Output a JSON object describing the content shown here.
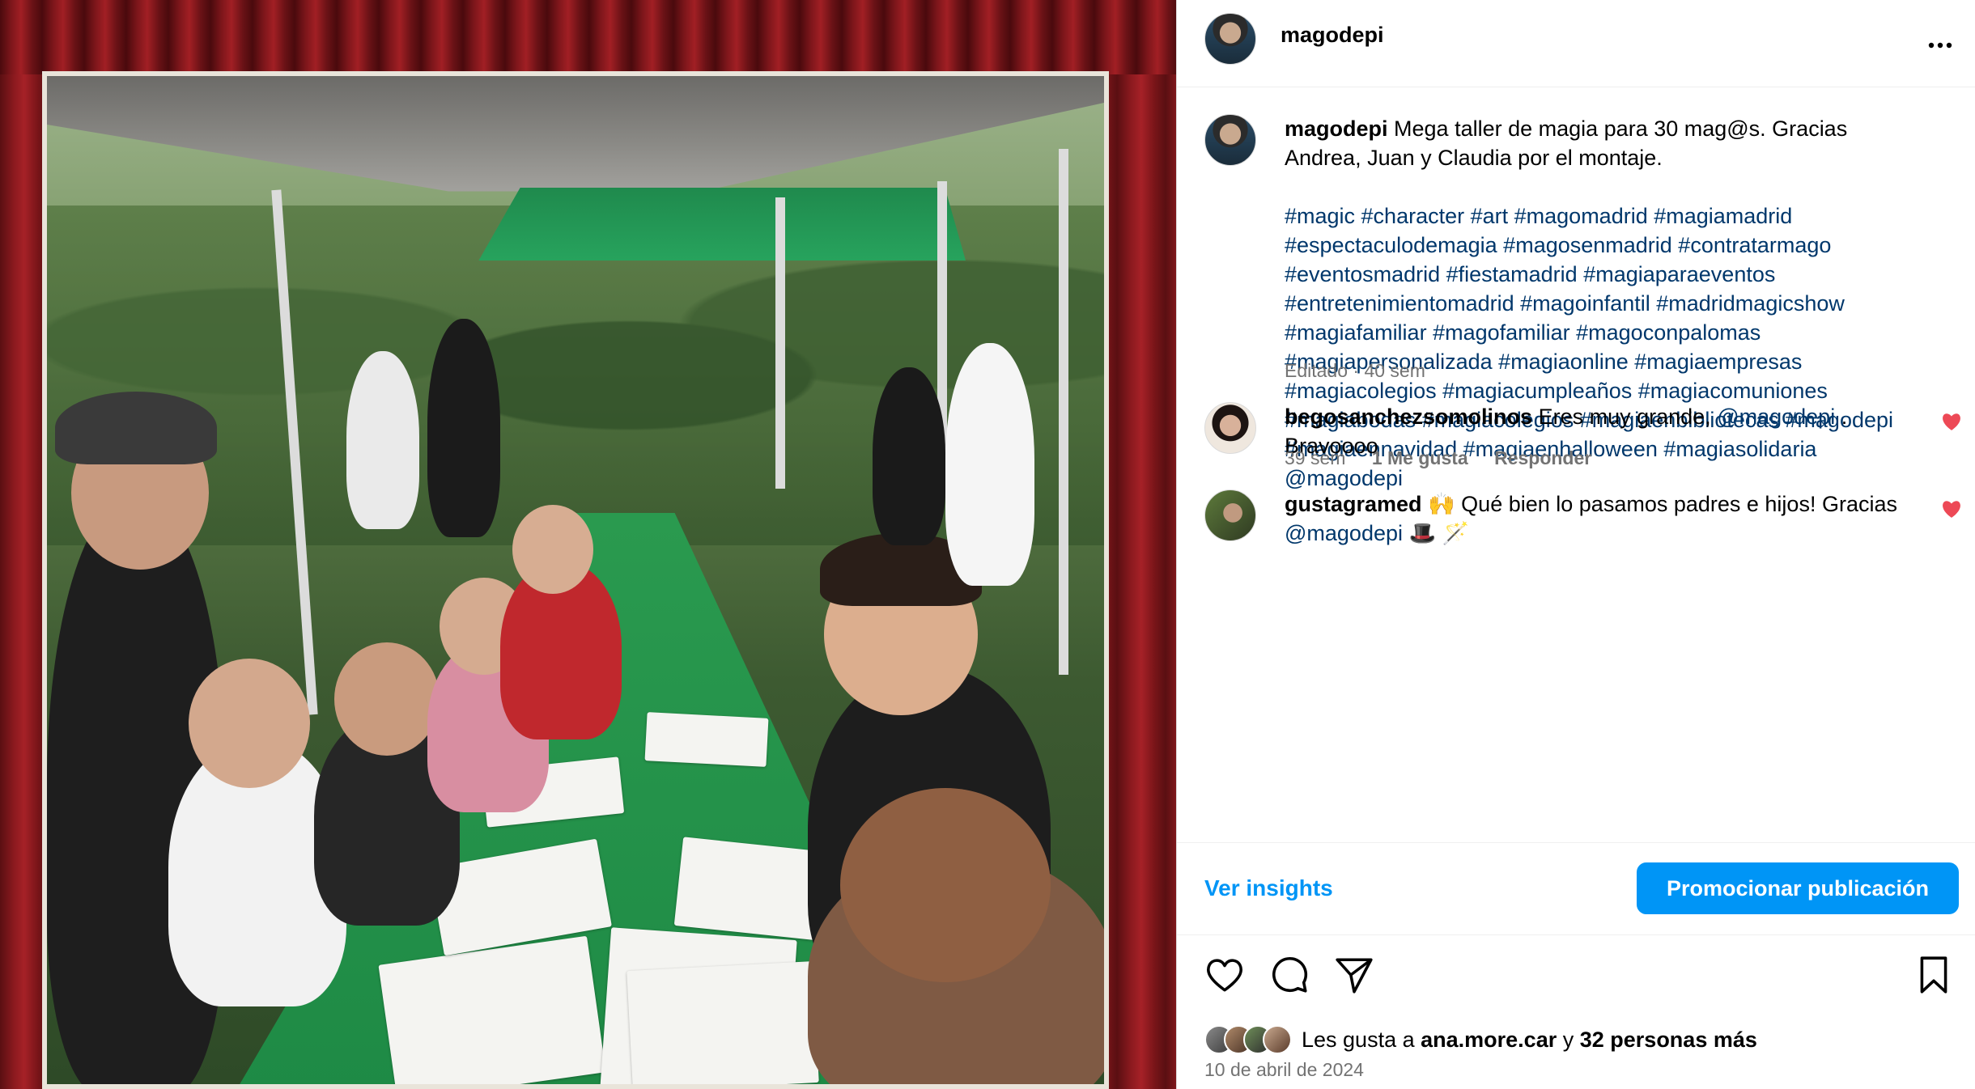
{
  "post": {
    "username": "magodepi",
    "more_icon": "more-horizontal-icon",
    "caption_user": "magodepi",
    "caption_text": "Mega taller de magia para 30 mag@s. Gracias Andrea, Juan y Claudia por el montaje.",
    "hashtags": "#magic #character #art #magomadrid #magiamadrid #espectaculodemagia #magosenmadrid #contratarmago #eventosmadrid #fiestamadrid #magiaparaeventos #entretenimientomadrid #magoinfantil #madridmagicshow #magiafamiliar #magofamiliar #magoconpalomas #magiapersonalizada #magiaonline #magiaempresas #magiacolegios #magiacumpleaños #magiacomuniones #magiabodas #magiacolegios #magiaenbibliotecas #magodepi #magiaennavidad #magiaenhalloween #magiasolidaria @magodepi",
    "caption_meta": "Editado · 40 sem"
  },
  "comments": [
    {
      "user": "begosanchezsomolinos",
      "text": "Eres muy grande,",
      "mention": "@magodepi",
      "text_after": ". Bravoooo",
      "time": "39 sem",
      "likes": "1 Me gusta",
      "reply": "Responder"
    },
    {
      "user": "gustagramed",
      "text": "🙌 Qué bien lo pasamos padres e hijos! Gracias",
      "mention": "@magodepi",
      "text_after": "🎩 🪄"
    }
  ],
  "actions": {
    "insights": "Ver insights",
    "promote": "Promocionar publicación"
  },
  "icons": [
    "heart-icon",
    "comment-icon",
    "share-icon",
    "bookmark-icon"
  ],
  "likes": {
    "prefix": "Les gusta a",
    "user": "ana.more.car",
    "connector": "y",
    "others": "32 personas más"
  },
  "date": "10 de abril de 2024",
  "colors": {
    "link": "#00376b",
    "accent": "#0095f6",
    "like": "#ed4956",
    "muted": "#737373"
  }
}
